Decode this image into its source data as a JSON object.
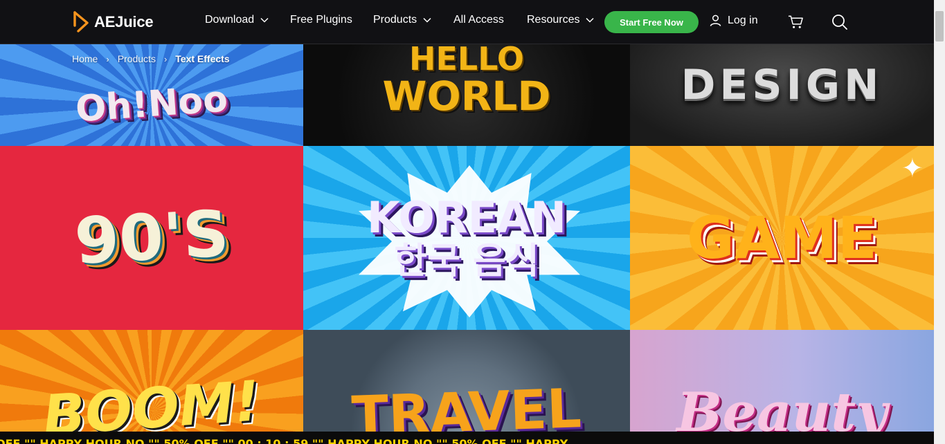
{
  "brand": {
    "name": "AEJuice",
    "accent": "#f7941d"
  },
  "nav": {
    "download": "Download",
    "free_plugins": "Free Plugins",
    "products": "Products",
    "all_access": "All Access",
    "resources": "Resources",
    "cta": "Start Free Now",
    "login": "Log in"
  },
  "icons": {
    "logo": "aejuice-play-logo-icon",
    "login": "user-icon",
    "cart": "cart-icon",
    "search": "search-icon",
    "chevron": "chevron-down-icon"
  },
  "colors": {
    "header_bg": "#111114",
    "cta_bg": "#39b54a",
    "ticker_text": "#ffd400"
  },
  "breadcrumb": {
    "home": "Home",
    "products": "Products",
    "current": "Text Effects"
  },
  "grid": {
    "tiles": [
      {
        "text": "Oh!Noo"
      },
      {
        "text": "HELLO",
        "text2": "WORLD"
      },
      {
        "text": "DESIGN"
      },
      {
        "text": "90'S"
      },
      {
        "text": "KOREAN",
        "text2": "한국 음식"
      },
      {
        "text": "GAME"
      },
      {
        "text": "BOOM!"
      },
      {
        "text": "TRAVEL"
      },
      {
        "text": "Beauty"
      }
    ]
  },
  "ticker": {
    "text": "OFF  \"\"  HAPPY HOUR NO  \"\"  50% OFF  \"\"  00 : 10 : 59  \"\"  HAPPY HOUR NO  \"\"  50% OFF  \"\"  HAPPY"
  }
}
